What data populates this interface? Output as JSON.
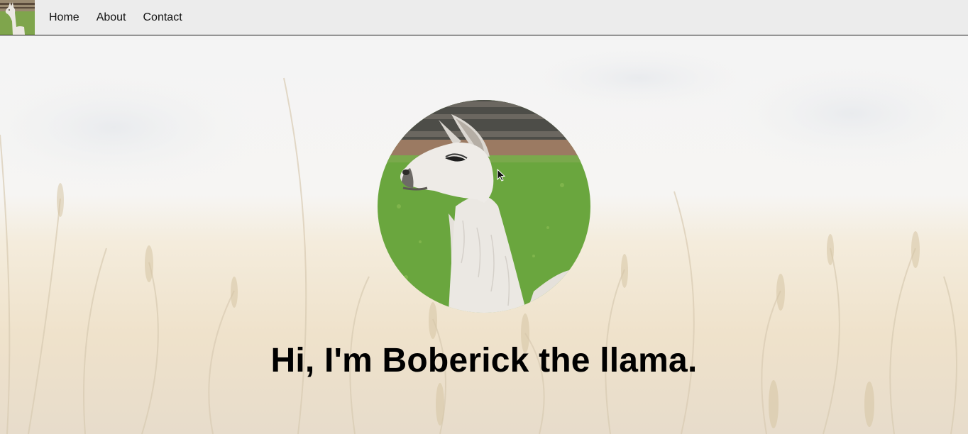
{
  "nav": {
    "logo_icon": "llama-thumbnail-icon",
    "links": [
      {
        "label": "Home"
      },
      {
        "label": "About"
      },
      {
        "label": "Contact"
      }
    ]
  },
  "hero": {
    "background": "wheat-field-image",
    "avatar": "llama-portrait-image",
    "title": "Hi, I'm Boberick the llama."
  },
  "colors": {
    "nav_bg": "#ececec",
    "nav_border": "#1a1a1a",
    "text": "#000000"
  }
}
